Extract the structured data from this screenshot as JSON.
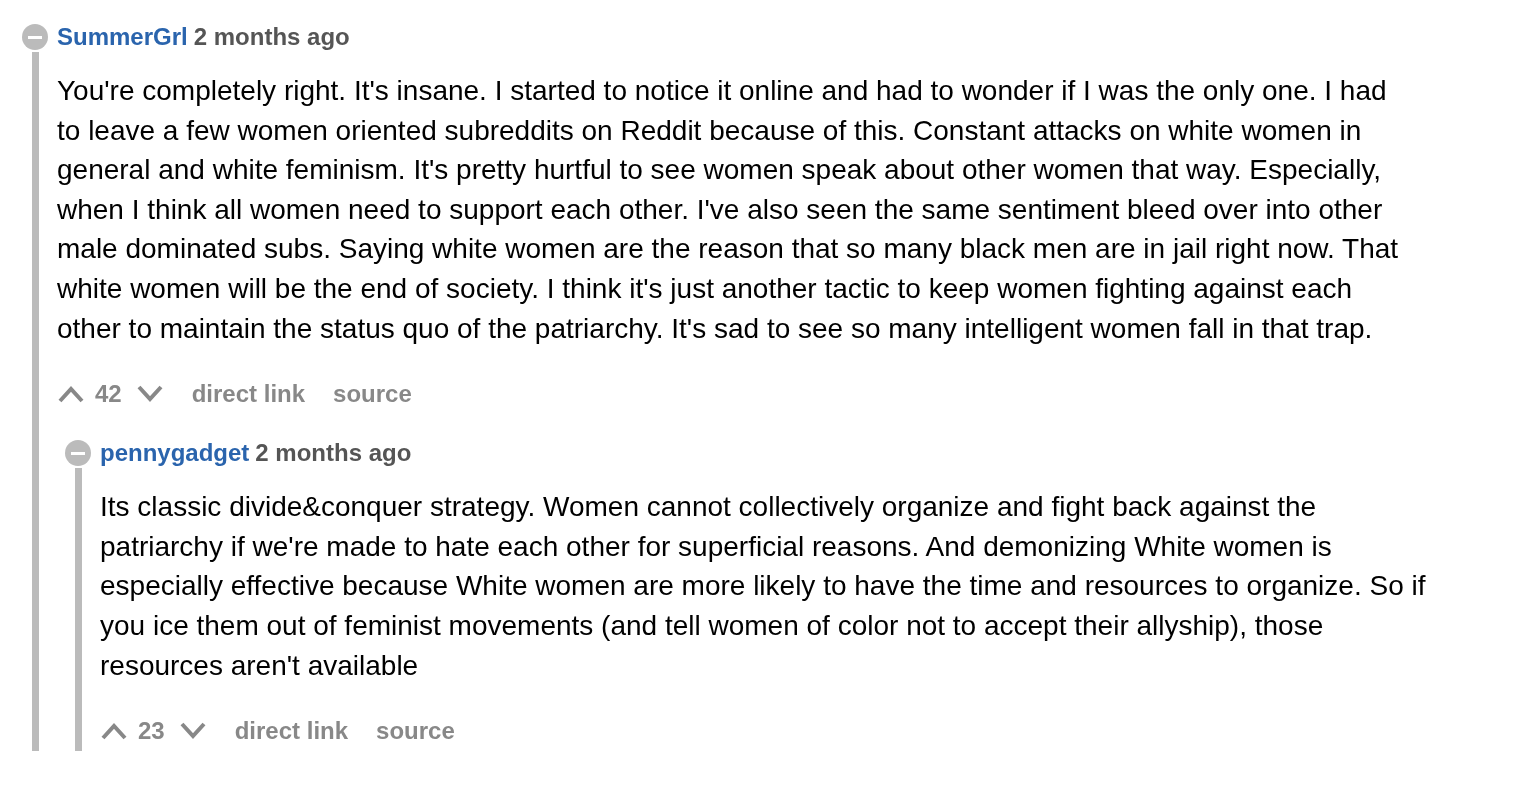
{
  "comments": [
    {
      "author": "SummerGrl",
      "time": "2 months ago",
      "body": "You're completely right. It's insane. I started to notice it online and had to wonder if I was the only one. I had to leave a few women oriented subreddits on Reddit because of this. Constant attacks on white women in general and white feminism. It's pretty hurtful to see women speak about other women that way. Especially, when I think all women need to support each other. I've also seen the same sentiment bleed over into other male dominated subs. Saying white women are the reason that so many black men are in jail right now. That white women will be the end of society. I think it's just another tactic to keep women fighting against each other to maintain the status quo of the patriarchy. It's sad to see so many intelligent women fall in that trap.",
      "score": "42",
      "links": [
        "direct link",
        "source"
      ],
      "expanded": true,
      "children": [
        {
          "author": "pennygadget",
          "time": "2 months ago",
          "body": "Its classic divide&conquer strategy. Women cannot collectively organize and fight back against the patriarchy if we're made to hate each other for superficial reasons. And demonizing White women is especially effective because White women are more likely to have the time and resources to organize. So if you ice them out of feminist movements (and tell women of color not to accept their allyship), those resources aren't available",
          "score": "23",
          "links": [
            "direct link",
            "source"
          ],
          "expanded": true
        }
      ]
    }
  ]
}
